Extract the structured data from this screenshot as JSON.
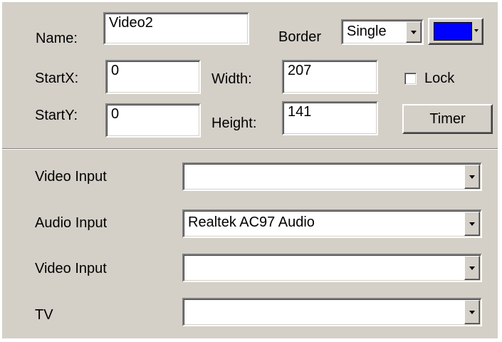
{
  "video": {
    "name_label": "Name:",
    "name_value": "Video2",
    "border_label": "Border",
    "border_value": "Single",
    "border_color": "#0000ff",
    "startx_label": "StartX:",
    "startx_value": "0",
    "starty_label": "StartY:",
    "starty_value": "0",
    "width_label": "Width:",
    "width_value": "207",
    "height_label": "Height:",
    "height_value": "141",
    "lock_label": "Lock",
    "lock_checked": false,
    "timer_label": "Timer"
  },
  "inputs": [
    {
      "label": "Video Input",
      "value": ""
    },
    {
      "label": "Audio Input",
      "value": "Realtek AC97 Audio"
    },
    {
      "label": "Video Input",
      "value": ""
    },
    {
      "label": "TV",
      "value": ""
    }
  ]
}
